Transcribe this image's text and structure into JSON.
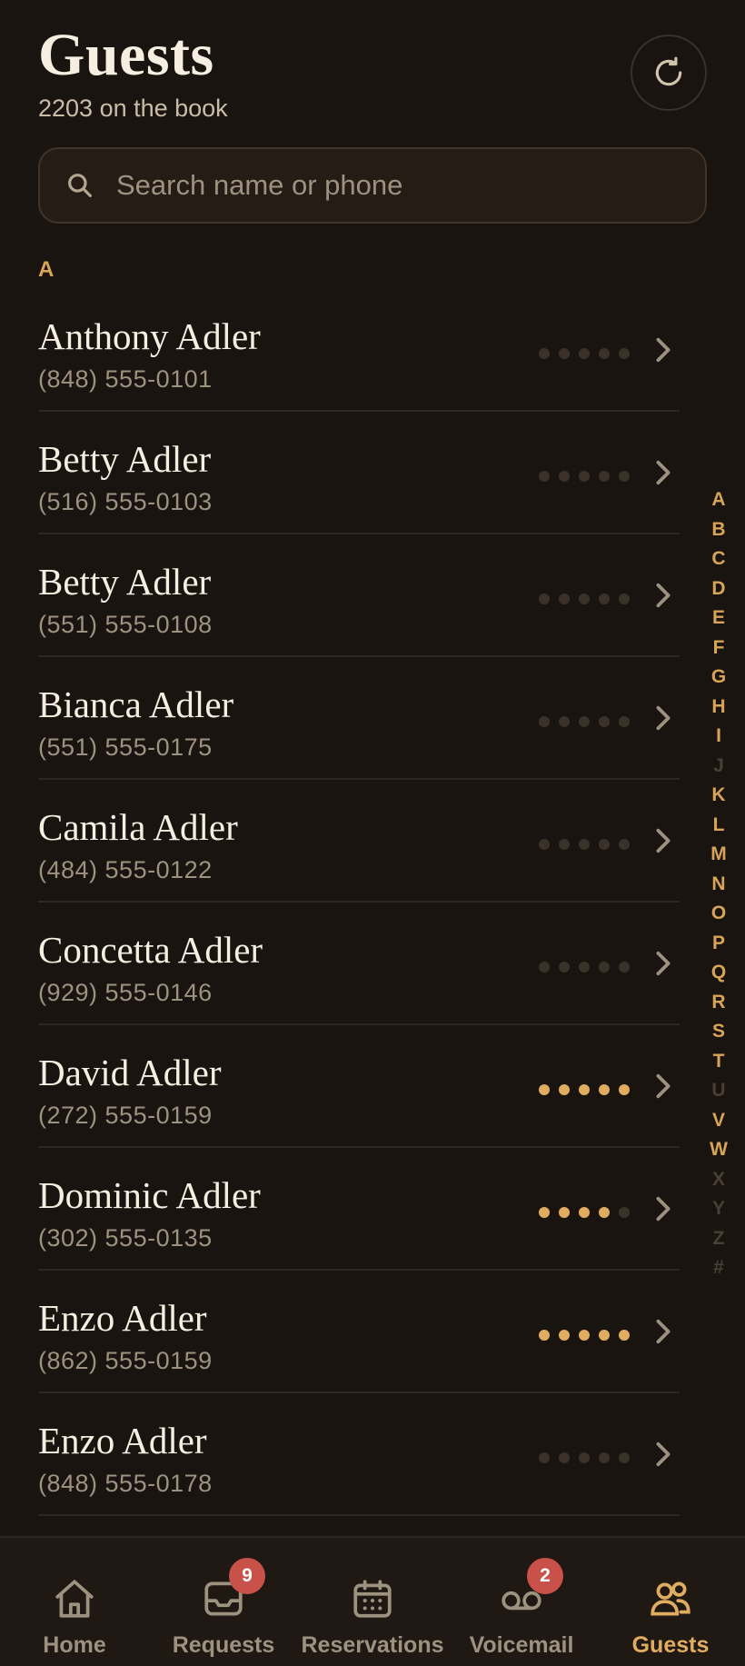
{
  "header": {
    "title": "Guests",
    "subtitle": "2203 on the book",
    "refresh_icon": "refresh-icon"
  },
  "search": {
    "placeholder": "Search name or phone",
    "value": "",
    "icon": "search-icon"
  },
  "section": {
    "letter": "A"
  },
  "guests": [
    {
      "name": "Anthony Adler",
      "phone": "(848) 555-0101",
      "rating": 0
    },
    {
      "name": "Betty Adler",
      "phone": "(516) 555-0103",
      "rating": 0
    },
    {
      "name": "Betty Adler",
      "phone": "(551) 555-0108",
      "rating": 0
    },
    {
      "name": "Bianca Adler",
      "phone": "(551) 555-0175",
      "rating": 0
    },
    {
      "name": "Camila Adler",
      "phone": "(484) 555-0122",
      "rating": 0
    },
    {
      "name": "Concetta Adler",
      "phone": "(929) 555-0146",
      "rating": 0
    },
    {
      "name": "David Adler",
      "phone": "(272) 555-0159",
      "rating": 5
    },
    {
      "name": "Dominic Adler",
      "phone": "(302) 555-0135",
      "rating": 4
    },
    {
      "name": "Enzo Adler",
      "phone": "(862) 555-0159",
      "rating": 5
    },
    {
      "name": "Enzo Adler",
      "phone": "(848) 555-0178",
      "rating": 0
    }
  ],
  "rating_max": 5,
  "alphabet": [
    {
      "letter": "A",
      "enabled": true
    },
    {
      "letter": "B",
      "enabled": true
    },
    {
      "letter": "C",
      "enabled": true
    },
    {
      "letter": "D",
      "enabled": true
    },
    {
      "letter": "E",
      "enabled": true
    },
    {
      "letter": "F",
      "enabled": true
    },
    {
      "letter": "G",
      "enabled": true
    },
    {
      "letter": "H",
      "enabled": true
    },
    {
      "letter": "I",
      "enabled": true
    },
    {
      "letter": "J",
      "enabled": false
    },
    {
      "letter": "K",
      "enabled": true
    },
    {
      "letter": "L",
      "enabled": true
    },
    {
      "letter": "M",
      "enabled": true
    },
    {
      "letter": "N",
      "enabled": true
    },
    {
      "letter": "O",
      "enabled": true
    },
    {
      "letter": "P",
      "enabled": true
    },
    {
      "letter": "Q",
      "enabled": true
    },
    {
      "letter": "R",
      "enabled": true
    },
    {
      "letter": "S",
      "enabled": true
    },
    {
      "letter": "T",
      "enabled": true
    },
    {
      "letter": "U",
      "enabled": false
    },
    {
      "letter": "V",
      "enabled": true
    },
    {
      "letter": "W",
      "enabled": true
    },
    {
      "letter": "X",
      "enabled": false
    },
    {
      "letter": "Y",
      "enabled": false
    },
    {
      "letter": "Z",
      "enabled": false
    },
    {
      "letter": "#",
      "enabled": false
    }
  ],
  "tabs": [
    {
      "label": "Home",
      "icon": "home-icon",
      "badge": null,
      "active": false
    },
    {
      "label": "Requests",
      "icon": "inbox-icon",
      "badge": "9",
      "active": false
    },
    {
      "label": "Reservations",
      "icon": "calendar-icon",
      "badge": null,
      "active": false
    },
    {
      "label": "Voicemail",
      "icon": "voicemail-icon",
      "badge": "2",
      "active": false
    },
    {
      "label": "Guests",
      "icon": "guests-icon",
      "badge": null,
      "active": true
    }
  ],
  "colors": {
    "background": "#1a1410",
    "accent": "#e0ad60",
    "badge": "#c8524a",
    "muted": "#9d917f"
  }
}
